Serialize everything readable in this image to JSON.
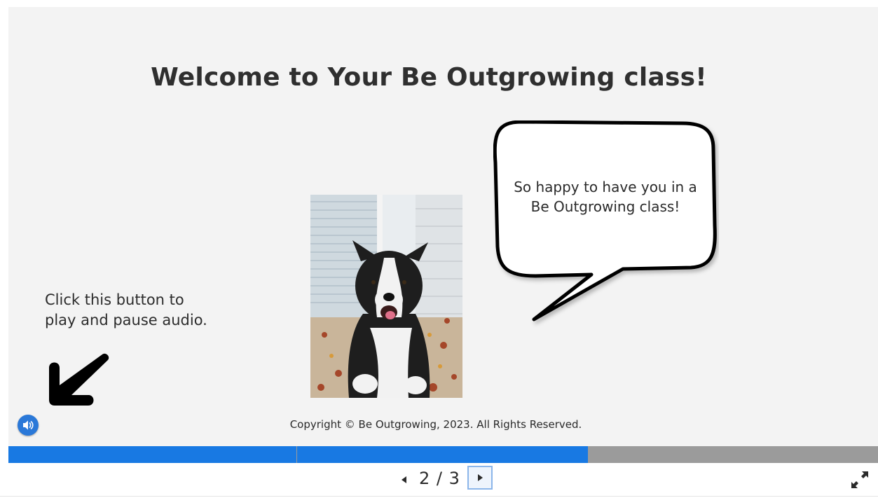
{
  "slide": {
    "title": "Welcome to Your Be Outgrowing class!",
    "speech_bubble": [
      "So happy to have you in a",
      "Be Outgrowing class!"
    ],
    "instruction": [
      "Click this button to",
      "play and pause audio."
    ],
    "copyright": "Copyright © Be Outgrowing, 2023. All Rights Reserved.",
    "photo": "dog-photo"
  },
  "player": {
    "audio_icon": "speaker-icon",
    "progress": {
      "segments": 3,
      "completed": 2
    },
    "nav": {
      "current": "2",
      "separator": "/",
      "total": "3"
    },
    "icons": {
      "prev": "caret-left-icon",
      "next": "caret-right-icon",
      "fullscreen": "expand-icon"
    },
    "colors": {
      "progress_fill": "#1879e3",
      "progress_track": "#9b9b9b",
      "audio_button": "#2a78d8"
    }
  }
}
